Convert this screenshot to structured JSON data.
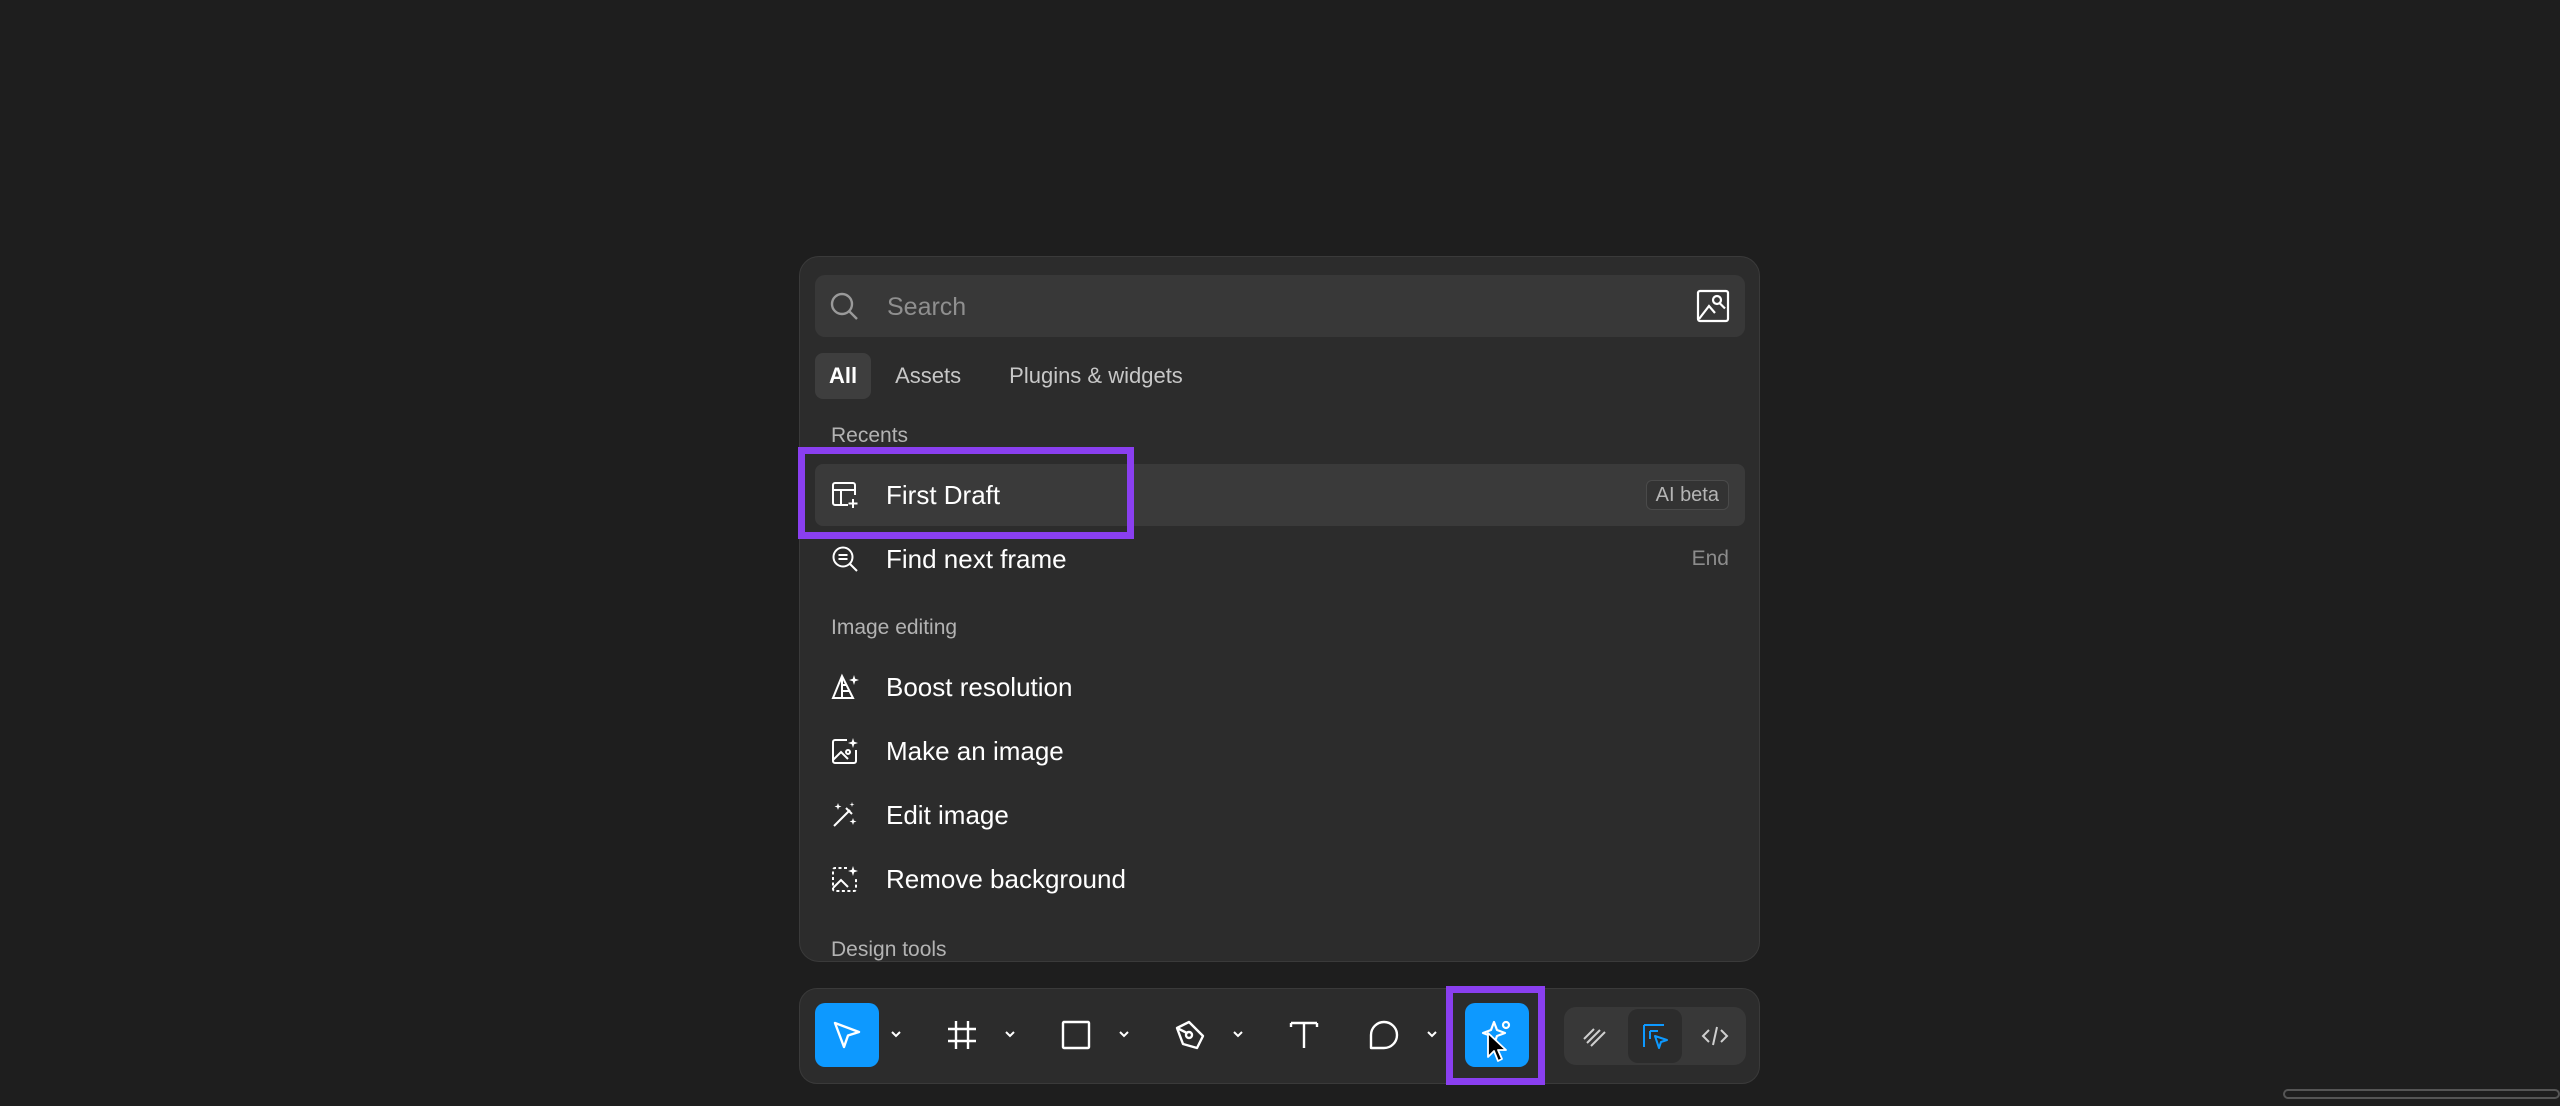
{
  "search": {
    "placeholder": "Search"
  },
  "tabs": [
    {
      "label": "All",
      "active": true
    },
    {
      "label": "Assets",
      "active": false
    },
    {
      "label": "Plugins & widgets",
      "active": false
    }
  ],
  "sections": {
    "recents": {
      "title": "Recents",
      "items": [
        {
          "label": "First Draft",
          "icon": "layout-add-icon",
          "badge": "AI beta"
        },
        {
          "label": "Find next frame",
          "icon": "search-frame-icon",
          "shortcut": "End"
        }
      ]
    },
    "image_editing": {
      "title": "Image editing",
      "items": [
        {
          "label": "Boost resolution",
          "icon": "boost-resolution-icon"
        },
        {
          "label": "Make an image",
          "icon": "make-image-icon"
        },
        {
          "label": "Edit image",
          "icon": "edit-image-icon"
        },
        {
          "label": "Remove background",
          "icon": "remove-background-icon"
        }
      ]
    },
    "design_tools": {
      "title": "Design tools"
    }
  },
  "toolbar": {
    "tools": [
      "move-icon",
      "frame-icon",
      "rectangle-icon",
      "pen-icon",
      "text-icon",
      "comment-icon",
      "actions-icon"
    ],
    "modes": [
      "draw-mode-icon",
      "design-mode-icon",
      "dev-mode-icon"
    ]
  },
  "colors": {
    "accent": "#0d99ff",
    "highlight_outline": "#8a3ff0",
    "background": "#1e1e1e",
    "panel": "#2c2c2c"
  }
}
